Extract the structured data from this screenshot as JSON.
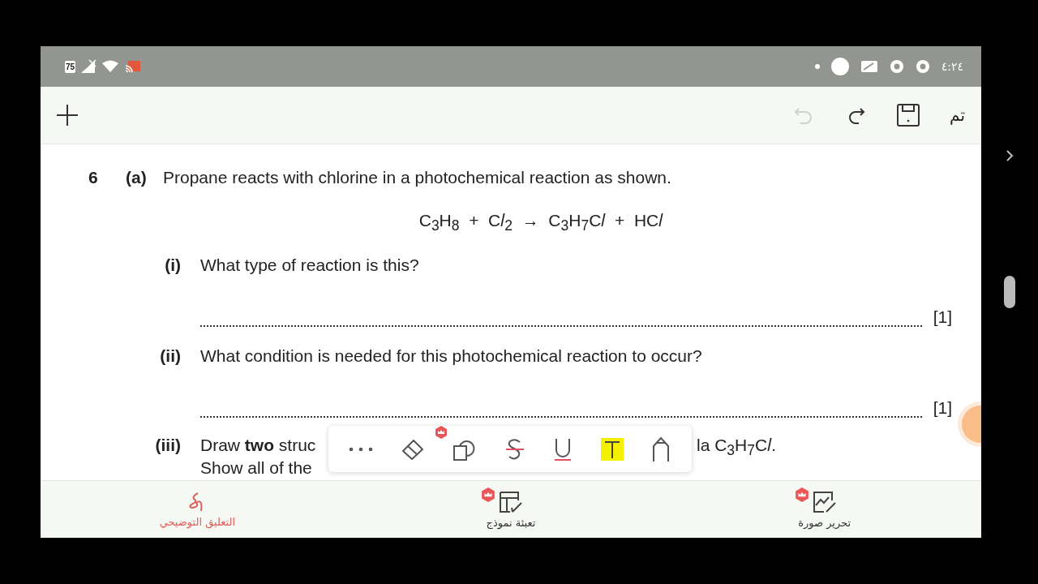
{
  "status_bar": {
    "battery": "75",
    "time": "٤:٢٤"
  },
  "toolbar": {
    "undo_disabled": true,
    "done": "تم"
  },
  "question": {
    "number": "6",
    "part": "(a)",
    "stem": "Propane reacts with chlorine in a photochemical reaction as shown.",
    "equation": "C$_{3}$H$_{8}$  +  C𝑙$_{2}$  →  C$_{3}$H$_{7}$C𝑙  +  HC𝑙",
    "subparts": [
      {
        "kind": "answer",
        "label": "(i)",
        "text": "What type of reaction is this?",
        "marks": "[1]"
      },
      {
        "kind": "answer",
        "label": "(ii)",
        "text": "What condition is needed for this photochemical reaction to occur?",
        "marks": "[1]"
      },
      {
        "kind": "covered",
        "label": "(iii)",
        "text_start": "Draw **two** struc",
        "text_end": "la C$_{3}$H$_{7}$C𝑙.",
        "second_line": "Show all of the"
      }
    ]
  },
  "annotation_toolbar": [
    {
      "kind": "more",
      "premium": false
    },
    {
      "kind": "eraser",
      "premium": false
    },
    {
      "kind": "shapes",
      "premium": true
    },
    {
      "kind": "strike",
      "premium": false
    },
    {
      "kind": "underline",
      "premium": false
    },
    {
      "kind": "highlight",
      "premium": false
    },
    {
      "kind": "pen",
      "premium": false
    }
  ],
  "bottom_nav": [
    {
      "kind": "image",
      "label": "تحرير صورة",
      "selected": false,
      "premium": true
    },
    {
      "kind": "form",
      "label": "تعبئة نموذج",
      "selected": false,
      "premium": true
    },
    {
      "kind": "annotate",
      "label": "التعليق التوضيحي",
      "selected": true,
      "premium": false
    }
  ]
}
